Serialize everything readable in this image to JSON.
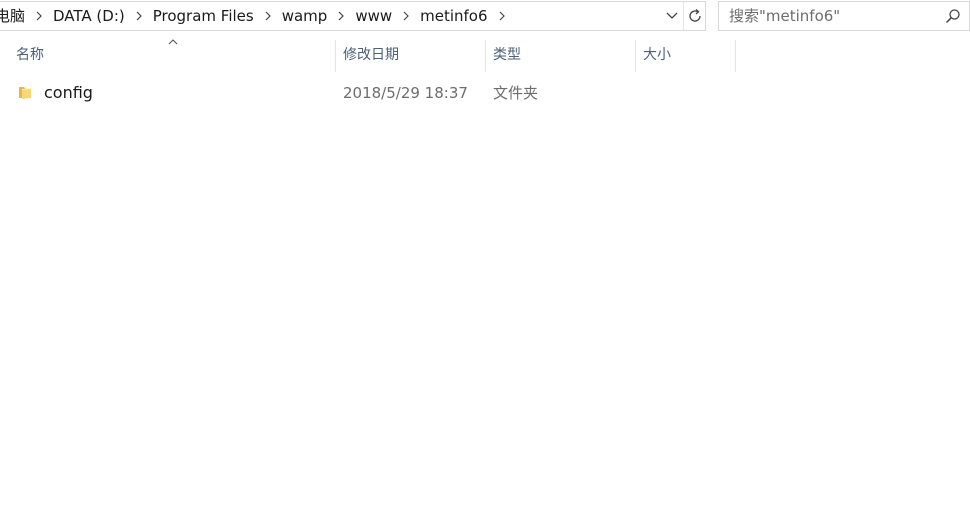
{
  "address": {
    "crumbs": [
      "电脑",
      "DATA (D:)",
      "Program Files",
      "wamp",
      "www",
      "metinfo6"
    ]
  },
  "search": {
    "placeholder": "搜索\"metinfo6\""
  },
  "columns": {
    "name": "名称",
    "modified": "修改日期",
    "type": "类型",
    "size": "大小"
  },
  "files": [
    {
      "name": "config",
      "modified": "2018/5/29 18:37",
      "type": "文件夹",
      "size": ""
    }
  ],
  "colors": {
    "header_text": "#4c607a",
    "secondary_text": "#6d6d6d",
    "folder_yellow": "#f8d775"
  }
}
